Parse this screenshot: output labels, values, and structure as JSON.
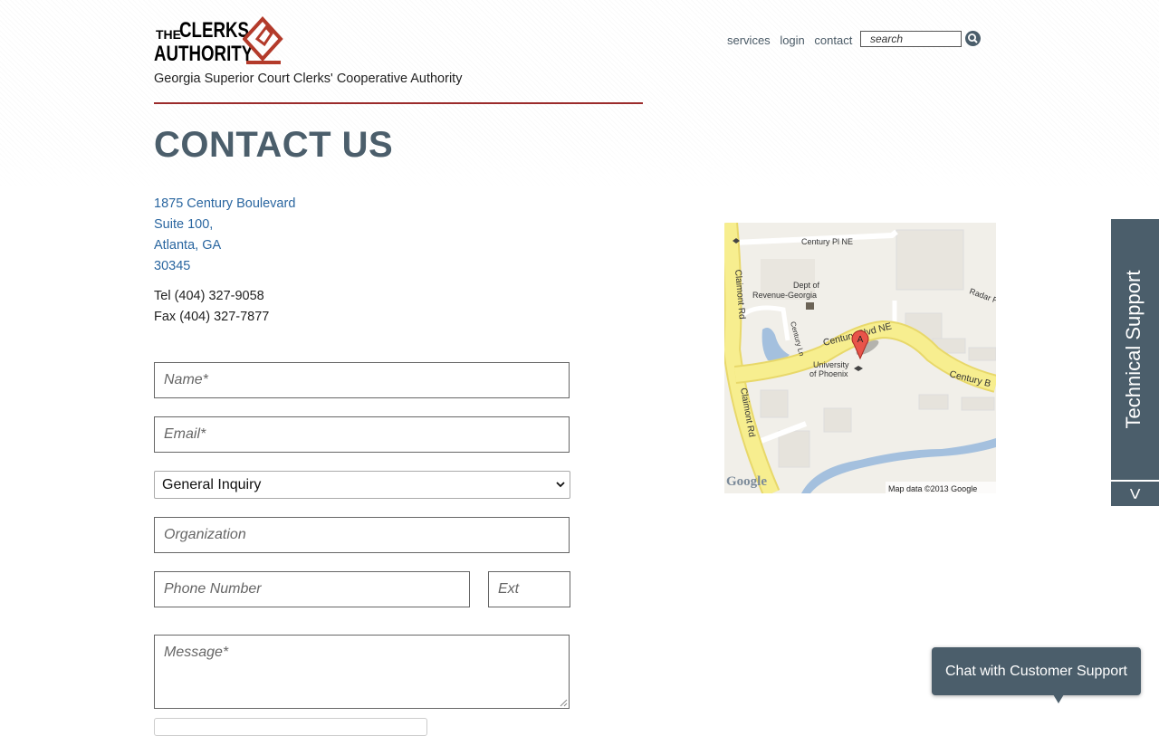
{
  "header": {
    "logo": {
      "the": "THE",
      "clerks": "CLERKS",
      "authority": "AUTHORITY"
    },
    "tagline": "Georgia Superior Court Clerks' Cooperative Authority",
    "nav": [
      {
        "label": "services"
      },
      {
        "label": "login"
      },
      {
        "label": "contact"
      }
    ],
    "search": {
      "placeholder": "search",
      "icon": "search-icon"
    }
  },
  "page": {
    "title": "CONTACT US"
  },
  "address": {
    "lines": [
      "1875 Century Boulevard",
      "Suite 100,",
      "Atlanta, GA",
      "30345"
    ],
    "tel": "Tel (404) 327-9058",
    "fax": "Fax (404) 327-7877"
  },
  "form": {
    "name_placeholder": "Name*",
    "email_placeholder": "Email*",
    "inquiry_selected": "General Inquiry",
    "organization_placeholder": "Organization",
    "phone_placeholder": "Phone Number",
    "ext_placeholder": "Ext",
    "message_placeholder": "Message*"
  },
  "map": {
    "labels": {
      "century_pl": "Century Pl NE",
      "dept1": "Dept of",
      "dept2": "Revenue-Georgia",
      "radar": "Radar F",
      "claimont_top": "Claimont Rd",
      "century_ln": "Century Ln",
      "century_blvd": "Century Blvd NE",
      "century_b": "Century B",
      "univ1": "University",
      "univ2": "of Phoenix",
      "claimont_bottom": "Claimont Rd",
      "marker": "A",
      "google": "Google",
      "copyright": "Map data ©2013 Google"
    },
    "colors": {
      "road": "#f7ee8f",
      "water": "#a4c0de",
      "land": "#f1efe9"
    }
  },
  "support_tab": {
    "label": "Technical Support",
    "toggle": "<"
  },
  "chat": {
    "label": "Chat with Customer Support"
  },
  "colors": {
    "brand": "#4b5e6b",
    "accent_rule": "#9b2b2b",
    "link": "#2a66a0",
    "logo_red": "#b33a2a"
  }
}
